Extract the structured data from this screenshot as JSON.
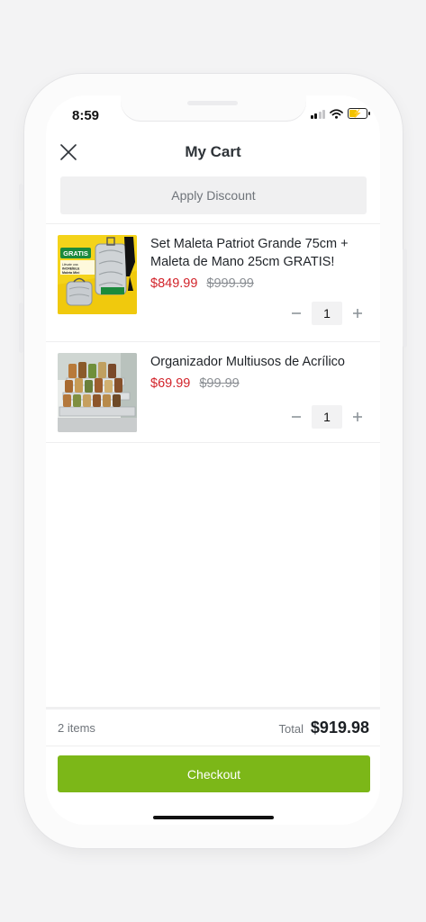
{
  "status_bar": {
    "time": "8:59"
  },
  "header": {
    "title": "My Cart"
  },
  "discount": {
    "label": "Apply Discount"
  },
  "items": [
    {
      "name": "Set Maleta Patriot Grande 75cm + Maleta de Mano 25cm GRATIS!",
      "sale_price": "$849.99",
      "original_price": "$999.99",
      "quantity": "1",
      "image_badge": "GRATIS",
      "image_caption": "Llévate una INCREÍBLE Maleta Mini"
    },
    {
      "name": "Organizador Multiusos de Acrílico",
      "sale_price": "$69.99",
      "original_price": "$99.99",
      "quantity": "1"
    }
  ],
  "summary": {
    "item_count": "2 items",
    "total_label": "Total",
    "total_value": "$919.98"
  },
  "checkout": {
    "label": "Checkout"
  },
  "colors": {
    "accent": "#7cb718",
    "sale": "#d2232a",
    "muted": "#8a8e93"
  },
  "icons": [
    "close-icon",
    "minus-icon",
    "plus-icon",
    "signal-icon",
    "wifi-icon",
    "battery-icon"
  ]
}
